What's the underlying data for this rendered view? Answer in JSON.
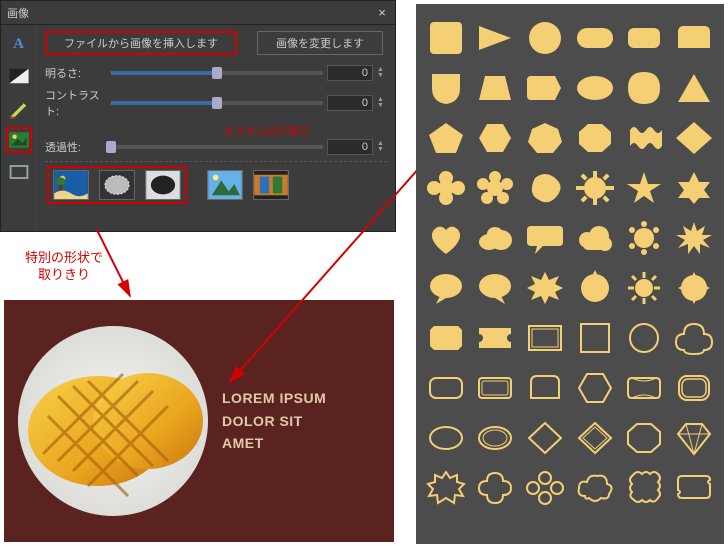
{
  "dialog": {
    "title": "画像",
    "close_glyph": "×",
    "btn_insert": "ファイルから画像を挿入します",
    "btn_change": "画像を変更します",
    "sliders": {
      "brightness_label": "明るさ:",
      "brightness_value": "0",
      "contrast_label": "コントラスト:",
      "contrast_value": "0",
      "opacity_label": "透過性:",
      "opacity_value": "0"
    },
    "custom_crop_caption": "カスタム切り取り",
    "side_tools": {
      "text_glyph": "A",
      "gradient_glyph": "◧",
      "pen_glyph": "✎",
      "image_glyph": "🖼",
      "rect_glyph": "▭"
    },
    "thumbs": {
      "scene": "scene-thumb",
      "dotted_circle": "dotted-circle-thumb",
      "oval_mask": "oval-mask-thumb",
      "mountain": "mountain-thumb",
      "film": "film-thumb"
    }
  },
  "annotation": {
    "line1": "特別の形状で",
    "line2": "取りきり"
  },
  "card": {
    "line1": "LOREM IPSUM",
    "line2": "DOLOR SIT",
    "line3": "AMET"
  },
  "shapes_panel": {
    "fill": "#f5cf73",
    "bg": "#4c4c4c"
  }
}
